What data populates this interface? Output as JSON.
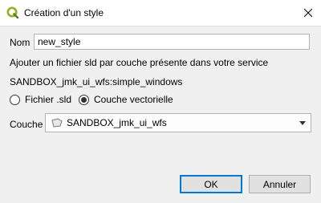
{
  "window": {
    "title": "Création d'un style",
    "app_icon": "qgis-icon",
    "close_icon": "close-icon"
  },
  "form": {
    "name_label": "Nom",
    "name_value": "new_style",
    "info_text": "Ajouter un fichier sld par couche présente dans votre service",
    "layer_ref": "SANDBOX_jmk_ui_wfs:simple_windows",
    "radio_options": [
      {
        "label": "Fichier .sld",
        "checked": false
      },
      {
        "label": "Couche vectorielle",
        "checked": true
      }
    ],
    "couche_label": "Couche",
    "couche_value": "SANDBOX_jmk_ui_wfs",
    "couche_icon": "polygon-layer-icon"
  },
  "buttons": {
    "ok": "OK",
    "cancel": "Annuler"
  },
  "colors": {
    "accent": "#0078d7",
    "qgis_green": "#93b023"
  }
}
